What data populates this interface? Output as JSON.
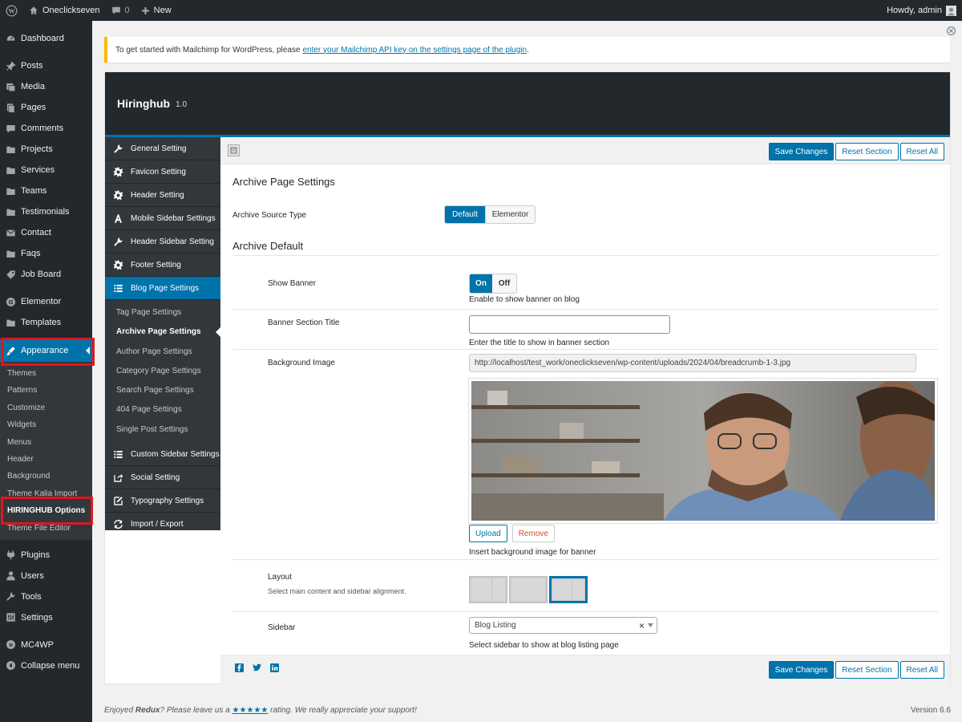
{
  "admin_bar": {
    "site_name": "Oneclickseven",
    "comments_count": "0",
    "new_label": "New",
    "howdy": "Howdy, admin"
  },
  "admin_menu": {
    "items_top": [
      {
        "label": "Dashboard",
        "icon": "dashboard-icon"
      }
    ],
    "items_content": [
      {
        "label": "Posts",
        "icon": "pin-icon"
      },
      {
        "label": "Media",
        "icon": "media-icon"
      },
      {
        "label": "Pages",
        "icon": "pages-icon"
      },
      {
        "label": "Comments",
        "icon": "comment-icon"
      },
      {
        "label": "Projects",
        "icon": "folder-icon"
      },
      {
        "label": "Services",
        "icon": "folder-icon"
      },
      {
        "label": "Teams",
        "icon": "folder-icon"
      },
      {
        "label": "Testimonials",
        "icon": "folder-icon"
      },
      {
        "label": "Contact",
        "icon": "mail-icon"
      },
      {
        "label": "Faqs",
        "icon": "folder-icon"
      },
      {
        "label": "Job Board",
        "icon": "tag-icon"
      }
    ],
    "items_builder": [
      {
        "label": "Elementor",
        "icon": "elementor-icon"
      },
      {
        "label": "Templates",
        "icon": "folder-icon"
      }
    ],
    "appearance": {
      "label": "Appearance",
      "icon": "paintbrush-icon"
    },
    "appearance_sub": [
      "Themes",
      "Patterns",
      "Customize",
      "Widgets",
      "Menus",
      "Header",
      "Background",
      "Theme Kalia Import",
      "HIRINGHUB Options",
      "Theme File Editor"
    ],
    "items_bottom": [
      {
        "label": "Plugins",
        "icon": "plugin-icon"
      },
      {
        "label": "Users",
        "icon": "user-icon"
      },
      {
        "label": "Tools",
        "icon": "wrench-icon"
      },
      {
        "label": "Settings",
        "icon": "settings-icon"
      }
    ],
    "items_extra": [
      {
        "label": "MC4WP",
        "icon": "mc4wp-icon"
      },
      {
        "label": "Collapse menu",
        "icon": "collapse-icon"
      }
    ],
    "highlight_color": "#e0161e"
  },
  "notice": {
    "text": "To get started with Mailchimp for WordPress, please",
    "link": "enter your Mailchimp API key on the settings page of the plugin",
    "end": "."
  },
  "redux": {
    "title": "Hiringhub",
    "version": "1.0",
    "tabs_before": [
      {
        "label": "General Setting",
        "icon": "wrench-icon"
      },
      {
        "label": "Favicon Setting",
        "icon": "gear-icon"
      },
      {
        "label": "Header Setting",
        "icon": "gear-icon"
      },
      {
        "label": "Mobile Sidebar Settings",
        "icon": "font-icon"
      },
      {
        "label": "Header Sidebar Setting",
        "icon": "wrench-icon"
      },
      {
        "label": "Footer Setting",
        "icon": "gear-icon"
      },
      {
        "label": "Blog Page Settings",
        "icon": "list-icon"
      }
    ],
    "subtabs": [
      "Tag Page Settings",
      "Archive Page Settings",
      "Author Page Settings",
      "Category Page Settings",
      "Search Page Settings",
      "404 Page Settings",
      "Single Post Settings"
    ],
    "tabs_after": [
      {
        "label": "Custom Sidebar Settings",
        "icon": "list-icon"
      },
      {
        "label": "Social Setting",
        "icon": "share-icon"
      },
      {
        "label": "Typography Settings",
        "icon": "edit-icon"
      },
      {
        "label": "Import / Export",
        "icon": "refresh-icon"
      }
    ],
    "buttons": {
      "save": "Save Changes",
      "reset_section": "Reset Section",
      "reset_all": "Reset All"
    },
    "section_title": "Archive Page Settings",
    "archive_source": {
      "label": "Archive Source Type",
      "options": [
        "Default",
        "Elementor"
      ],
      "selected": "Default"
    },
    "archive_default_title": "Archive Default",
    "show_banner": {
      "label": "Show Banner",
      "on": "On",
      "off": "Off",
      "value": "On",
      "desc": "Enable to show banner on blog"
    },
    "banner_title": {
      "label": "Banner Section Title",
      "value": "",
      "desc": "Enter the title to show in banner section"
    },
    "background_image": {
      "label": "Background Image",
      "url": "http://localhost/test_work/oneclickseven/wp-content/uploads/2024/04/breadcrumb-1-3.jpg",
      "upload": "Upload",
      "remove": "Remove",
      "desc": "Insert background image for banner"
    },
    "layout": {
      "label": "Layout",
      "sublabel": "Select main content and sidebar alignment.",
      "selected_index": 2
    },
    "sidebar": {
      "label": "Sidebar",
      "value": "Blog Listing",
      "clear": "×",
      "desc": "Select sidebar to show at blog listing page"
    }
  },
  "footer": {
    "enjoyed": "Enjoyed",
    "redux": "Redux",
    "please": "? Please leave us a",
    "stars": "★★★★★",
    "rest": "rating. We really appreciate your support!",
    "version": "Version 6.6"
  },
  "colors": {
    "accent": "#0073aa",
    "dark": "#23282d",
    "remove": "#d54e21"
  }
}
